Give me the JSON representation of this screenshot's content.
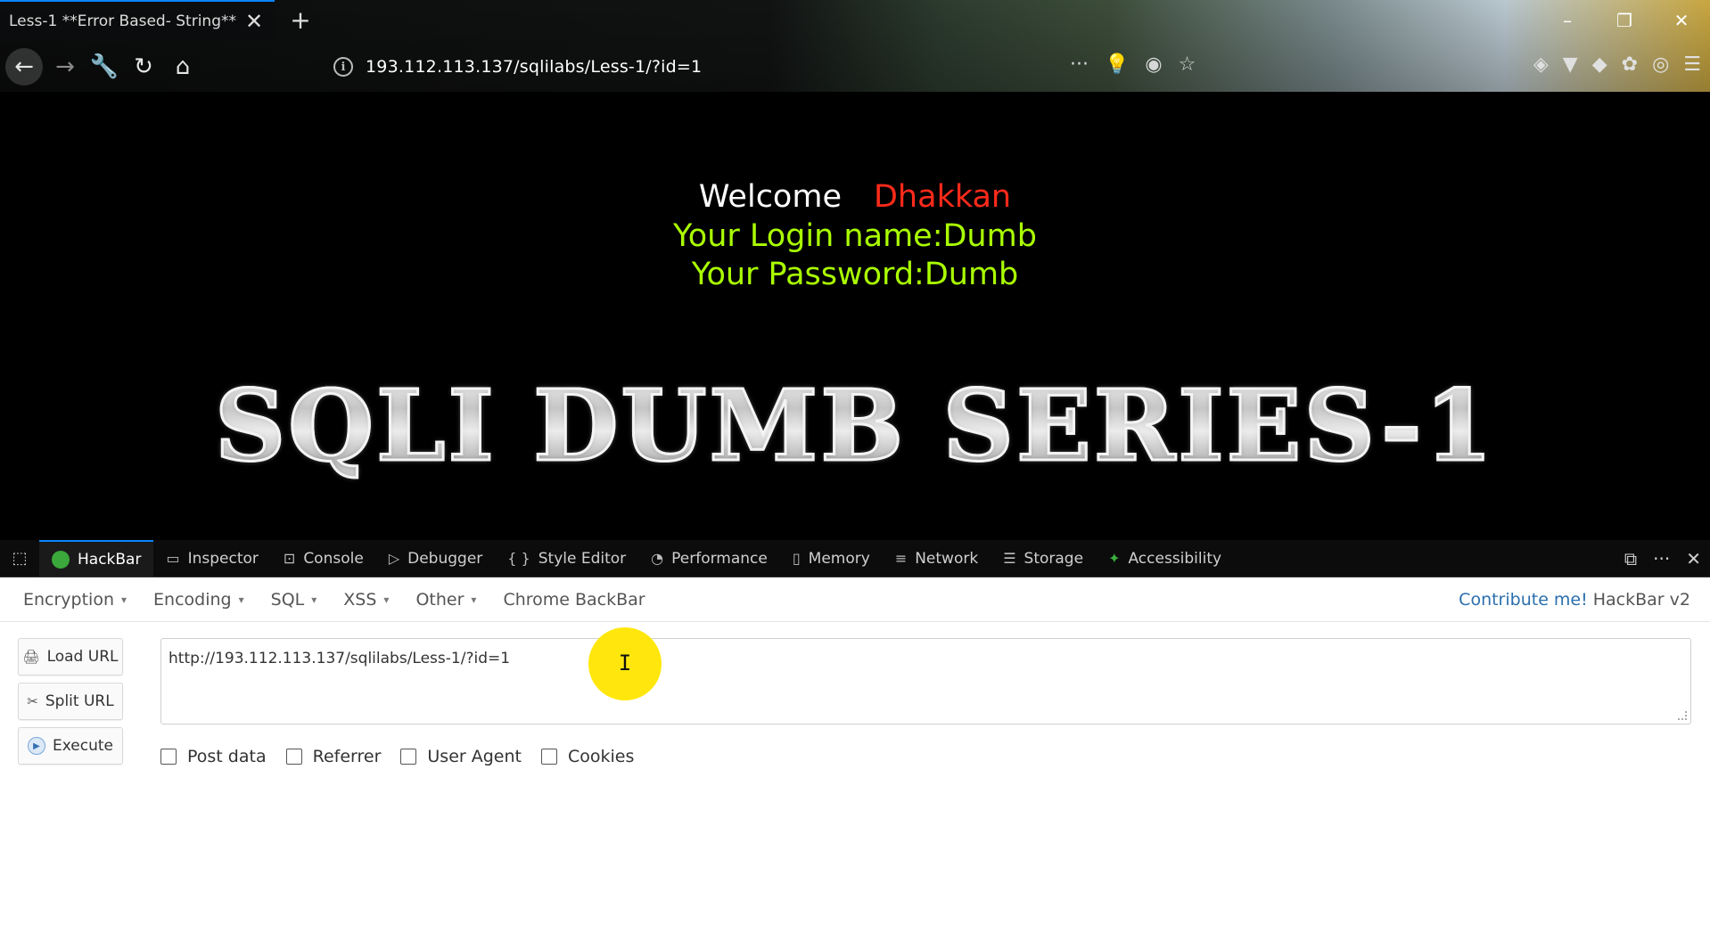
{
  "browser": {
    "tab_title": "Less-1 **Error Based- String**",
    "tab_close": "✕",
    "new_tab": "+",
    "url": "193.112.113.137/sqlilabs/Less-1/?id=1",
    "nav": {
      "back": "←",
      "forward": "→",
      "tools": "🔧",
      "reload": "↻",
      "home": "⌂"
    },
    "url_actions": [
      "···",
      "💡",
      "◉",
      "☆"
    ],
    "window_controls": {
      "minimize": "–",
      "restore": "❐",
      "close": "✕"
    }
  },
  "page": {
    "welcome_word": "Welcome",
    "welcome_name": "Dhakkan",
    "login_line": "Your Login name:Dumb",
    "password_line": "Your Password:Dumb",
    "banner": "SQLI DUMB SERIES-1",
    "colors": {
      "background": "#000000",
      "name": "#ff2a1a",
      "login": "#aaff00"
    }
  },
  "devtools": {
    "tabs": [
      {
        "label": "HackBar",
        "icon": "hackbar-icon",
        "active": true
      },
      {
        "label": "Inspector",
        "icon": "inspector-icon"
      },
      {
        "label": "Console",
        "icon": "console-icon"
      },
      {
        "label": "Debugger",
        "icon": "debugger-icon"
      },
      {
        "label": "Style Editor",
        "icon": "braces-icon"
      },
      {
        "label": "Performance",
        "icon": "performance-icon"
      },
      {
        "label": "Memory",
        "icon": "memory-icon"
      },
      {
        "label": "Network",
        "icon": "network-icon"
      },
      {
        "label": "Storage",
        "icon": "storage-icon"
      },
      {
        "label": "Accessibility",
        "icon": "accessibility-icon"
      }
    ],
    "right_controls": {
      "dock": "⧉",
      "more": "···",
      "close": "✕"
    },
    "tab_icons": {
      "inspector": "▭",
      "console": "⊡",
      "debugger": "▷",
      "style": "{ }",
      "performance": "◔",
      "memory": "▯",
      "network": "≡",
      "storage": "☰",
      "accessibility": "✦"
    },
    "picker_icon": "⬚"
  },
  "hackbar": {
    "menu": [
      {
        "label": "Encryption",
        "has_caret": true
      },
      {
        "label": "Encoding",
        "has_caret": true
      },
      {
        "label": "SQL",
        "has_caret": true
      },
      {
        "label": "XSS",
        "has_caret": true
      },
      {
        "label": "Other",
        "has_caret": true
      },
      {
        "label": "Chrome BackBar",
        "has_caret": false
      }
    ],
    "caret": "▾",
    "contribute": "Contribute me!",
    "version": "HackBar v2",
    "buttons": {
      "load_url": "Load URL",
      "split_url": "Split URL",
      "execute": "Execute"
    },
    "button_icons": {
      "load": "🖨",
      "split": "✂",
      "execute": "▶"
    },
    "url_value": "http://193.112.113.137/sqlilabs/Less-1/?id=1",
    "checkboxes": [
      {
        "label": "Post data",
        "checked": false
      },
      {
        "label": "Referrer",
        "checked": false
      },
      {
        "label": "User Agent",
        "checked": false
      },
      {
        "label": "Cookies",
        "checked": false
      }
    ],
    "cursor": "I"
  }
}
